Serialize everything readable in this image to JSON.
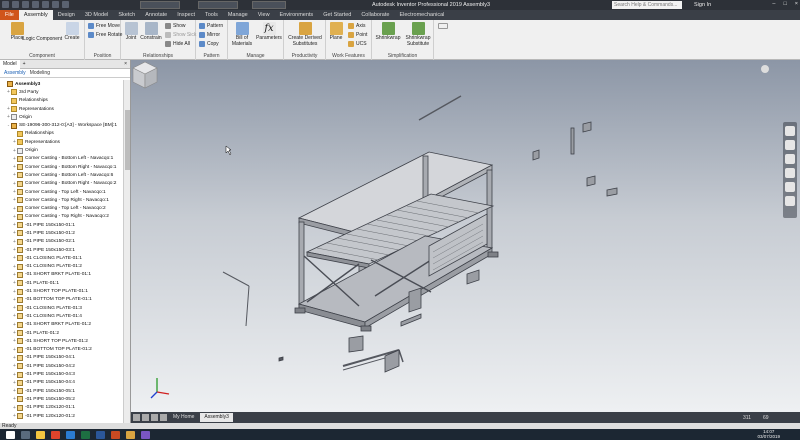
{
  "window": {
    "title": "Autodesk Inventor Professional 2019    Assembly3",
    "search_placeholder": "Search Help & Commands...",
    "sign_in": "Sign In"
  },
  "ribbon_tabs": [
    "File",
    "Assembly",
    "Design",
    "3D Model",
    "Sketch",
    "Annotate",
    "Inspect",
    "Tools",
    "Manage",
    "View",
    "Environments",
    "Get Started",
    "Collaborate",
    "Electromechanical"
  ],
  "active_tab": "Assembly",
  "ribbon": {
    "component": {
      "label": "Component",
      "place": "Place",
      "ilogic": "iLogic",
      "create": "Create",
      "component": "Component"
    },
    "position": {
      "label": "Position",
      "free_move": "Free Move",
      "free_rotate": "Free Rotate"
    },
    "relationships": {
      "label": "Relationships",
      "joint": "Joint",
      "constrain": "Constrain",
      "show": "Show",
      "show_sick": "Show Sick",
      "hide_all": "Hide All"
    },
    "pattern": {
      "label": "Pattern",
      "pattern": "Pattern",
      "mirror": "Mirror",
      "copy": "Copy"
    },
    "manage": {
      "label": "Manage",
      "bom": "Bill of Materials",
      "parameters": "Parameters"
    },
    "productivity": {
      "label": "Productivity",
      "create_derived": "Create Derived Substitutes"
    },
    "work_features": {
      "label": "Work Features",
      "plane": "Plane",
      "axis": "Axis",
      "point": "Point",
      "ucs": "UCS"
    },
    "simplification": {
      "label": "Simplification",
      "shrinkwrap": "Shrinkwrap",
      "shrinkwrap_sub": "Shrinkwrap Substitute"
    }
  },
  "panel": {
    "tabs": [
      "Model",
      "+"
    ],
    "browser_modes": [
      "Assembly",
      "Modeling"
    ],
    "tree": [
      {
        "label": "Assembly3",
        "icon": "asm",
        "exp": "",
        "bold": true
      },
      {
        "label": "3rd Party",
        "icon": "fold",
        "exp": "+"
      },
      {
        "label": "Relationships",
        "icon": "fold",
        "exp": ""
      },
      {
        "label": "Representations",
        "icon": "fold",
        "exp": "+"
      },
      {
        "label": "Origin",
        "icon": "org",
        "exp": "+"
      },
      {
        "label": "SE-19096-300-312-0:[A3] - Workspace [BM]:1",
        "icon": "asm",
        "exp": "-"
      },
      {
        "label": "Relationships",
        "icon": "fold",
        "exp": ""
      },
      {
        "label": "Representations",
        "icon": "fold",
        "exp": "+"
      },
      {
        "label": "Origin",
        "icon": "org",
        "exp": "+"
      },
      {
        "label": "Corner Casting - Bottom Left - Navacqo:1",
        "icon": "part",
        "exp": "+"
      },
      {
        "label": "Corner Casting - Bottom Right - Navacqo:1",
        "icon": "part",
        "exp": "+"
      },
      {
        "label": "Corner Casting - Bottom Left - Navacqo:6",
        "icon": "part",
        "exp": "+"
      },
      {
        "label": "Corner Casting - Bottom Right - Navacqo:2",
        "icon": "part",
        "exp": "+"
      },
      {
        "label": "Corner Casting - Top Left - Navacqo:1",
        "icon": "part",
        "exp": "+"
      },
      {
        "label": "Corner Casting - Top Right - Navacqo:1",
        "icon": "part",
        "exp": "+"
      },
      {
        "label": "Corner Casting - Top Left - Navacqo:2",
        "icon": "part",
        "exp": "+"
      },
      {
        "label": "Corner Casting - Top Right - Navacqo:2",
        "icon": "part",
        "exp": "+"
      },
      {
        "label": "-01 PIPE 150x150-01:1",
        "icon": "part",
        "exp": "+"
      },
      {
        "label": "-01 PIPE 150x150-01:2",
        "icon": "part",
        "exp": "+"
      },
      {
        "label": "-01 PIPE 150x150-02:1",
        "icon": "part",
        "exp": "+"
      },
      {
        "label": "-01 PIPE 150x150-03:1",
        "icon": "part",
        "exp": "+"
      },
      {
        "label": "-01 CLOSING PLATE-01:1",
        "icon": "part",
        "exp": "+"
      },
      {
        "label": "-01 CLOSING PLATE-01:2",
        "icon": "part",
        "exp": "+"
      },
      {
        "label": "-01 SHORT BRKT PLATE-01:1",
        "icon": "part",
        "exp": "+"
      },
      {
        "label": "-01 PLATE-01:1",
        "icon": "part",
        "exp": "+"
      },
      {
        "label": "-01 SHORT TOP PLATE-01:1",
        "icon": "part",
        "exp": "+"
      },
      {
        "label": "-01 BOTTOM TOP PLATE-01:1",
        "icon": "part",
        "exp": "+"
      },
      {
        "label": "-01 CLOSING PLATE-01:3",
        "icon": "part",
        "exp": "+"
      },
      {
        "label": "-01 CLOSING PLATE-01:4",
        "icon": "part",
        "exp": "+"
      },
      {
        "label": "-01 SHORT BRKT PLATE-01:2",
        "icon": "part",
        "exp": "+"
      },
      {
        "label": "-01 PLATE-01:2",
        "icon": "part",
        "exp": "+"
      },
      {
        "label": "-01 SHORT TOP PLATE-01:2",
        "icon": "part",
        "exp": "+"
      },
      {
        "label": "-01 BOTTOM TOP PLATE-01:2",
        "icon": "part",
        "exp": "+"
      },
      {
        "label": "-01 PIPE 150x150-04:1",
        "icon": "part",
        "exp": "+"
      },
      {
        "label": "-01 PIPE 150x150-04:2",
        "icon": "part",
        "exp": "+"
      },
      {
        "label": "-01 PIPE 150x150-04:3",
        "icon": "part",
        "exp": "+"
      },
      {
        "label": "-01 PIPE 150x150-04:4",
        "icon": "part",
        "exp": "+"
      },
      {
        "label": "-01 PIPE 150x150-05:1",
        "icon": "part",
        "exp": "+"
      },
      {
        "label": "-01 PIPE 150x150-05:2",
        "icon": "part",
        "exp": "+"
      },
      {
        "label": "-01 PIPE 120x120-01:1",
        "icon": "part",
        "exp": "+"
      },
      {
        "label": "-01 PIPE 120x120-01:2",
        "icon": "part",
        "exp": "+"
      }
    ]
  },
  "doc_tabs": [
    "My Home",
    "Assembly3"
  ],
  "active_doc": "Assembly3",
  "status": {
    "text": "Ready",
    "count_a": "311",
    "count_b": "69"
  },
  "clock": {
    "time": "14:07",
    "date": "03/07/2019"
  }
}
